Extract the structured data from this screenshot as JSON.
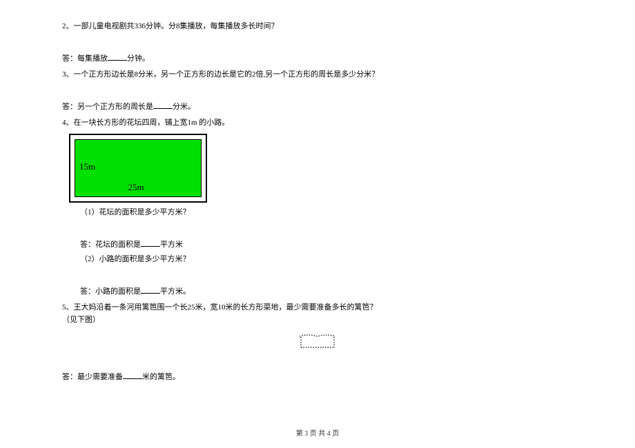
{
  "questions": {
    "q2": {
      "text": "2、一部儿童电视剧共336分钟。分8集播放，每集播放多长时间？",
      "answer_prefix": "答：每集播放",
      "answer_suffix": "分钟。"
    },
    "q3": {
      "text": "3、一个正方形边长是8分米，另一个正方形的边长是它的2倍,另一个正方形的周长是多少分米？",
      "answer_prefix": "答：另一个正方形的周长是",
      "answer_suffix": "分米。"
    },
    "q4": {
      "text": "4、在一块长方形的花坛四周，铺上宽1m 的小路。",
      "dim_width": "25m",
      "dim_height": "15m",
      "sub1_q": "（1）花坛的面积是多少平方米？",
      "sub1_answer_prefix": "答：花坛的面积是",
      "sub1_answer_suffix": "平方米",
      "sub2_q": "（2）小路的面积是多少平方米？",
      "sub2_answer_prefix": "答：小路的面积是",
      "sub2_answer_suffix": "平方米。"
    },
    "q5": {
      "text": "5、王大妈沿着一条河用篱笆围一个长25米，宽10米的长方形菜地，最少需要准备多长的篱笆？",
      "see_below": "（见下图）",
      "answer_prefix": "答：最少需要准备",
      "answer_suffix": "米的篱笆。"
    }
  },
  "footer": "第 3 页 共 4 页"
}
